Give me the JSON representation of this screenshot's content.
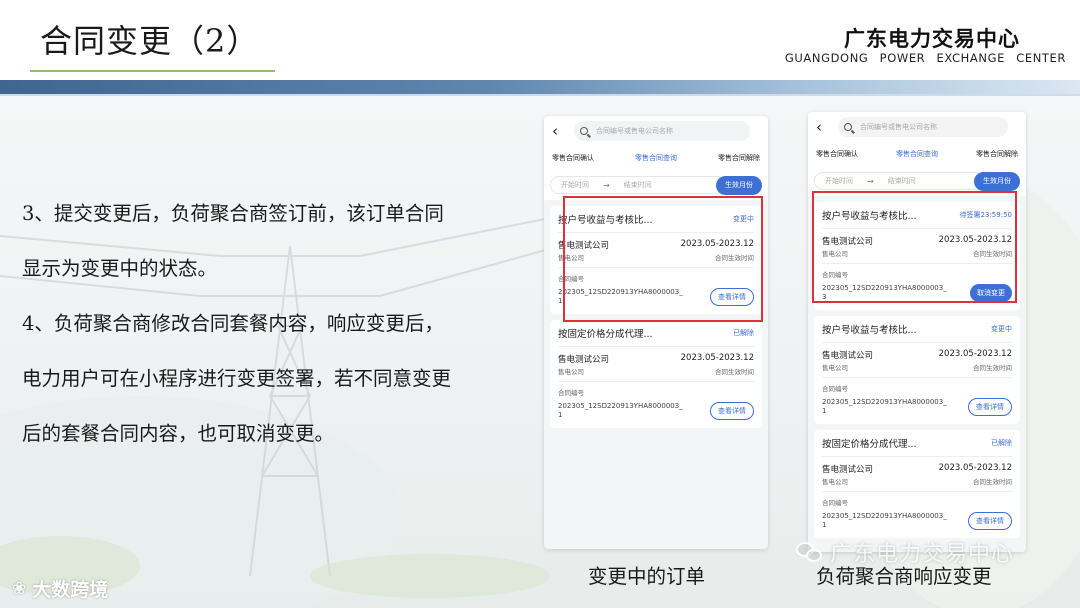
{
  "header": {
    "title": "合同变更（2）",
    "brand_cn": "广东电力交易中心",
    "brand_en": "GUANGDONG POWER EXCHANGE CENTER"
  },
  "body_text": [
    "3、提交变更后，负荷聚合商签订前，该订单合同",
    "显示为变更中的状态。",
    "4、负荷聚合商修改合同套餐内容，响应变更后，",
    "电力用户可在小程序进行变更签署，若不同意变更",
    "后的套餐合同内容，也可取消变更。"
  ],
  "phone1": {
    "search_placeholder": "合同编号或售电公司名称",
    "tabs": [
      "零售合同确认",
      "零售合同查询",
      "零售合同解除"
    ],
    "active_tab": 1,
    "start_placeholder": "开始时间",
    "end_placeholder": "结束时间",
    "generate_button": "生效月份",
    "cards": [
      {
        "title": "按户号收益与考核比...",
        "status": "变更中",
        "company": "售电测试公司",
        "company_sub": "售电公司",
        "period": "2023.05-2023.12",
        "period_sub": "合同生效时间",
        "no_label": "合同编号",
        "no_value": "202305_12SD220913YHA8000003_1",
        "button": "查看详情"
      },
      {
        "title": "按固定价格分成代理...",
        "status": "已解除",
        "company": "售电测试公司",
        "company_sub": "售电公司",
        "period": "2023.05-2023.12",
        "period_sub": "合同生效时间",
        "no_label": "合同编号",
        "no_value": "202305_12SD220913YHA8000003_1",
        "button": "查看详情"
      }
    ]
  },
  "phone2": {
    "search_placeholder": "合同编号或售电公司名称",
    "tabs": [
      "零售合同确认",
      "零售合同查询",
      "零售合同解除"
    ],
    "active_tab": 1,
    "start_placeholder": "开始时间",
    "end_placeholder": "结束时间",
    "generate_button": "生效月份",
    "cards": [
      {
        "title": "按户号收益与考核比...",
        "status": "待签署23:59:50",
        "company": "售电测试公司",
        "company_sub": "售电公司",
        "period": "2023.05-2023.12",
        "period_sub": "合同生效时间",
        "no_label": "合同编号",
        "no_value": "202305_12SD220913YHA8000003_3",
        "button": "取消变更"
      },
      {
        "title": "按户号收益与考核比...",
        "status": "变更中",
        "company": "售电测试公司",
        "company_sub": "售电公司",
        "period": "2023.05-2023.12",
        "period_sub": "合同生效时间",
        "no_label": "合同编号",
        "no_value": "202305_12SD220913YHA8000003_1",
        "button": "查看详情"
      },
      {
        "title": "按固定价格分成代理...",
        "status": "已解除",
        "company": "售电测试公司",
        "company_sub": "售电公司",
        "period": "2023.05-2023.12",
        "period_sub": "合同生效时间",
        "no_label": "合同编号",
        "no_value": "202305_12SD220913YHA8000003_1",
        "button": "查看详情"
      }
    ]
  },
  "captions": [
    "变更中的订单",
    "负荷聚合商响应变更"
  ],
  "watermark_left": "大数跨境",
  "watermark_right": "广东电力交易中心",
  "colors": {
    "accent": "#3d6fd6",
    "highlight": "#e0303a"
  },
  "icons": [
    "back-arrow-icon",
    "search-icon",
    "arrow-right-icon",
    "wechat-icon"
  ]
}
